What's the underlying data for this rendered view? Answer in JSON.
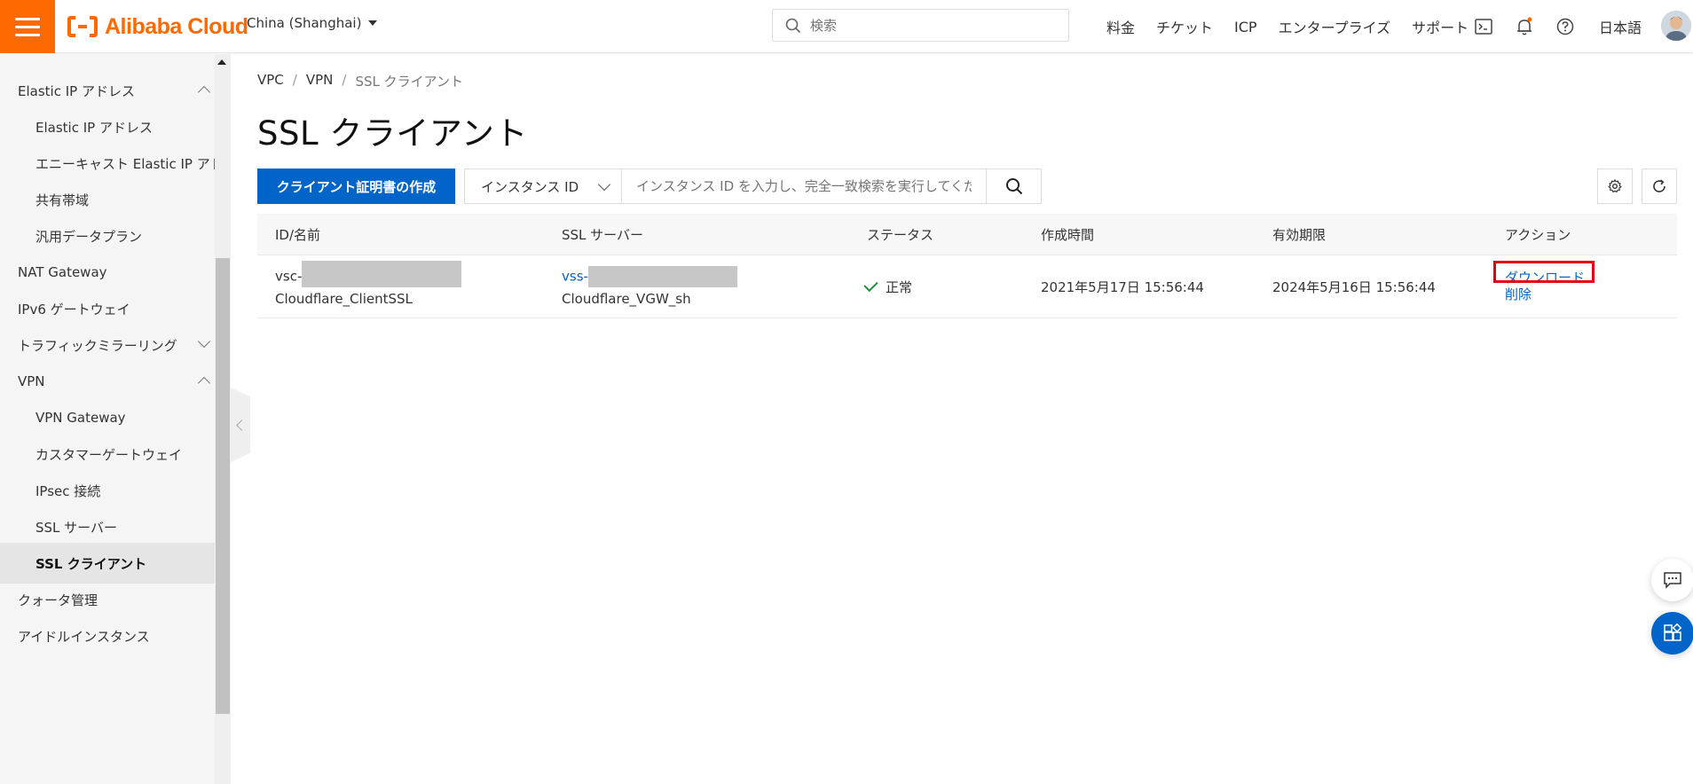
{
  "brand": {
    "name": "Alibaba Cloud",
    "color": "#ff6a00"
  },
  "topbar": {
    "region": "China (Shanghai)",
    "search_placeholder": "検索",
    "nav": [
      "料金",
      "チケット",
      "ICP",
      "エンタープライズ",
      "サポート"
    ],
    "icons": [
      "terminal-icon",
      "bell-icon",
      "help-icon"
    ],
    "language": "日本語"
  },
  "sidebar": {
    "items": [
      {
        "label": "Elastic IP アドレス",
        "level": 1,
        "expanded": true
      },
      {
        "label": "Elastic IP アドレス",
        "level": 2
      },
      {
        "label": "エニーキャスト Elastic IP アドレス",
        "level": 2
      },
      {
        "label": "共有帯域",
        "level": 2
      },
      {
        "label": "汎用データプラン",
        "level": 2
      },
      {
        "label": "NAT Gateway",
        "level": 1
      },
      {
        "label": "IPv6 ゲートウェイ",
        "level": 1
      },
      {
        "label": "トラフィックミラーリング",
        "level": 1,
        "expanded": false
      },
      {
        "label": "VPN",
        "level": 1,
        "expanded": true
      },
      {
        "label": "VPN Gateway",
        "level": 2
      },
      {
        "label": "カスタマーゲートウェイ",
        "level": 2
      },
      {
        "label": "IPsec 接続",
        "level": 2
      },
      {
        "label": "SSL サーバー",
        "level": 2
      },
      {
        "label": "SSL クライアント",
        "level": 2,
        "active": true
      },
      {
        "label": "クォータ管理",
        "level": 1
      },
      {
        "label": "アイドルインスタンス",
        "level": 1
      }
    ]
  },
  "breadcrumb": [
    "VPC",
    "VPN",
    "SSL クライアント"
  ],
  "page": {
    "title": "SSL クライアント",
    "create_button": "クライアント証明書の作成",
    "filter_field": "インスタンス ID",
    "filter_placeholder": "インスタンス ID を入力し、完全一致検索を実行してください"
  },
  "table": {
    "headers": [
      "ID/名前",
      "SSL サーバー",
      "ステータス",
      "作成時間",
      "有効期限",
      "アクション"
    ],
    "rows": [
      {
        "id_prefix": "vsc-",
        "name": "Cloudflare_ClientSSL",
        "server_id_prefix": "vss-",
        "server_name": "Cloudflare_VGW_sh",
        "status": "正常",
        "created": "2021年5月17日 15:56:44",
        "expires": "2024年5月16日 15:56:44",
        "actions": [
          "ダウンロード",
          "削除"
        ]
      }
    ]
  },
  "colors": {
    "primary": "#0064c8",
    "status_ok": "#1e8e3e",
    "highlight": "#e60012"
  }
}
